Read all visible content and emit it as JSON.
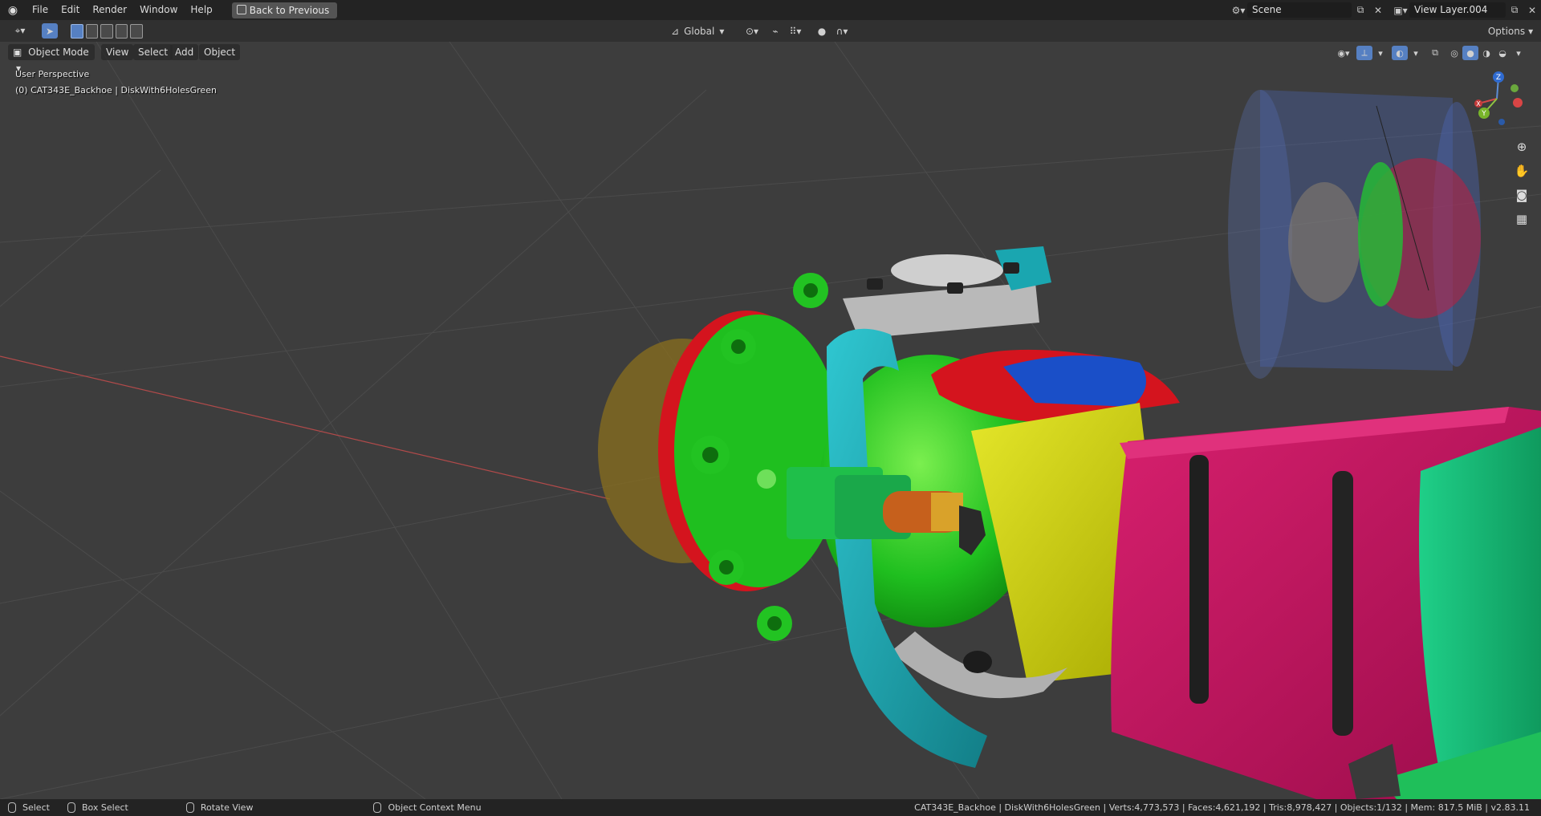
{
  "topbar": {
    "menu": [
      "File",
      "Edit",
      "Render",
      "Window",
      "Help"
    ],
    "back_button": "Back to Previous",
    "scene": "Scene",
    "view_layer": "View Layer.004"
  },
  "toolheader": {
    "transform_orientation": "Global",
    "options": "Options"
  },
  "viewport_header": {
    "mode": "Object Mode",
    "menus": [
      "View",
      "Select",
      "Add",
      "Object"
    ]
  },
  "viewport": {
    "perspective_label": "User Perspective",
    "active_object": "(0) CAT343E_Backhoe | DiskWith6HolesGreen",
    "axes": {
      "z": "Z",
      "y": "Y",
      "x": "X"
    }
  },
  "statusbar": {
    "select": "Select",
    "box_select": "Box Select",
    "rotate_view": "Rotate View",
    "context_menu": "Object Context Menu",
    "stats": "CAT343E_Backhoe | DiskWith6HolesGreen | Verts:4,773,573 | Faces:4,621,192 | Tris:8,978,427 | Objects:1/132 | Mem: 817.5 MiB | v2.83.11"
  },
  "colors": {
    "selection_blue": "#5680c2",
    "part_green": "#1fbf1f",
    "part_magenta": "#c2135e",
    "part_yellow": "#c5c800",
    "part_cyan": "#1aa6b0",
    "part_red": "#d4141e",
    "part_blue": "#1a4fc8",
    "part_teal": "#14b57a"
  }
}
